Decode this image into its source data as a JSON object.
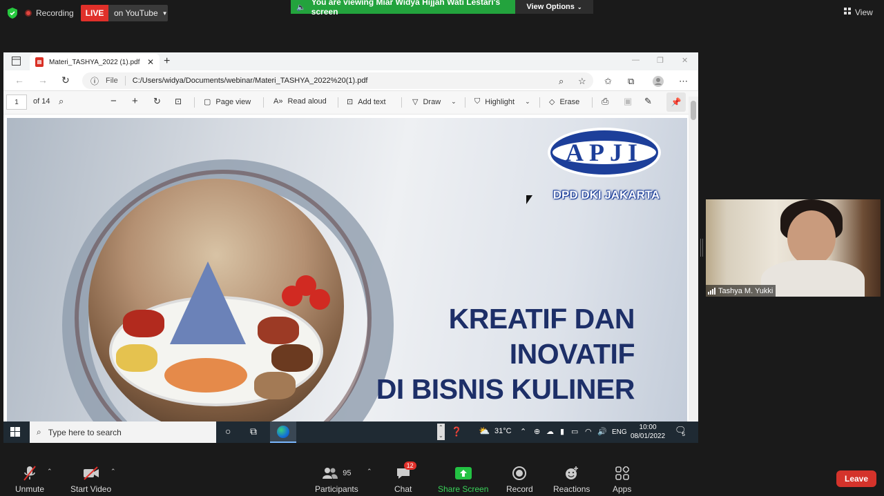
{
  "zoom_top": {
    "recording": "Recording",
    "live": "LIVE",
    "youtube": "on YouTube",
    "viewing_banner": "You are viewing Miar Widya Hijjah Wati Lestari's screen",
    "view_options": "View Options",
    "view": "View"
  },
  "browser": {
    "tab_title": "Materi_TASHYA_2022 (1).pdf",
    "address_label": "File",
    "address_url": "C:/Users/widya/Documents/webinar/Materi_TASHYA_2022%20(1).pdf"
  },
  "pdf_toolbar": {
    "page": "1",
    "of_pages": "of 14",
    "page_view": "Page view",
    "read_aloud": "Read aloud",
    "add_text": "Add text",
    "draw": "Draw",
    "highlight": "Highlight",
    "erase": "Erase"
  },
  "slide": {
    "logo_text": "APJI",
    "logo_subtitle": "DPD DKI JAKARTA",
    "headline_1": "KREATIF DAN",
    "headline_2": "INOVATIF",
    "headline_3": "DI BISNIS KULINER"
  },
  "taskbar": {
    "search_placeholder": "Type here to search",
    "temperature": "31°C",
    "language": "ENG",
    "time": "10:00",
    "date": "08/01/2022",
    "notification_count": "5"
  },
  "participant": {
    "name": "Tashya M. Yukki"
  },
  "zoom_bottom": {
    "unmute": "Unmute",
    "start_video": "Start Video",
    "participants": "Participants",
    "participants_count": "95",
    "chat": "Chat",
    "chat_badge": "12",
    "share_screen": "Share Screen",
    "record": "Record",
    "reactions": "Reactions",
    "apps": "Apps",
    "leave": "Leave"
  },
  "colors": {
    "live_red": "#e0302a",
    "viewing_green": "#23a33d",
    "slide_navy": "#1d2f68",
    "apji_blue": "#1d3f9a"
  }
}
